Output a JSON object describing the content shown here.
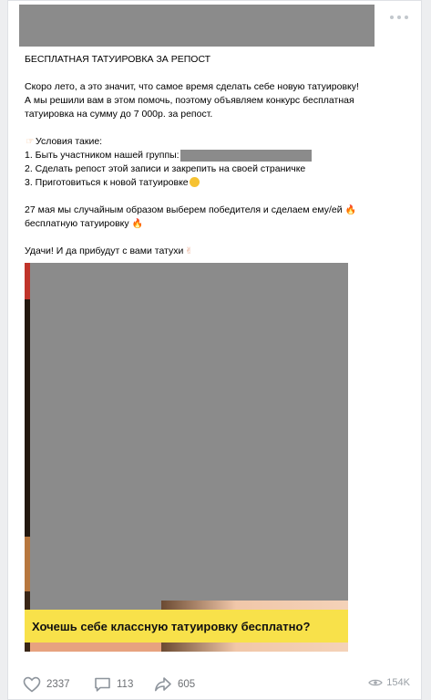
{
  "post": {
    "title_line": "БЕСПЛАТНАЯ ТАТУИРОВКА ЗА РЕПОСТ",
    "paragraph1": [
      "Скоро лето, а это значит, что самое время сделать себе новую татуировку!",
      "А мы решили вам в этом помочь, поэтому объявляем конкурс бесплатная",
      "татуировка на сумму до 7 000р. за репост."
    ],
    "conditions_header": "Условия такие:",
    "conditions": [
      "1. Быть участником нашей группы:",
      "2. Сделать репост этой записи и закрепить на своей страничке",
      "3. Приготовиться к новой татуировке"
    ],
    "paragraph2": [
      "27 мая мы случайным образом выберем победителя и сделаем ему/ей",
      "бесплатную татуировку"
    ],
    "closing": "Удачи! И да прибудут с вами татухи",
    "banner_text": "Хочешь себе классную татуировку бесплатно?"
  },
  "footer": {
    "likes": "2337",
    "comments": "113",
    "shares": "605",
    "views": "154K"
  },
  "icons": {
    "more": "more-dots-icon",
    "like": "heart-icon",
    "comment": "comment-icon",
    "share": "share-arrow-icon",
    "views": "eye-icon"
  }
}
